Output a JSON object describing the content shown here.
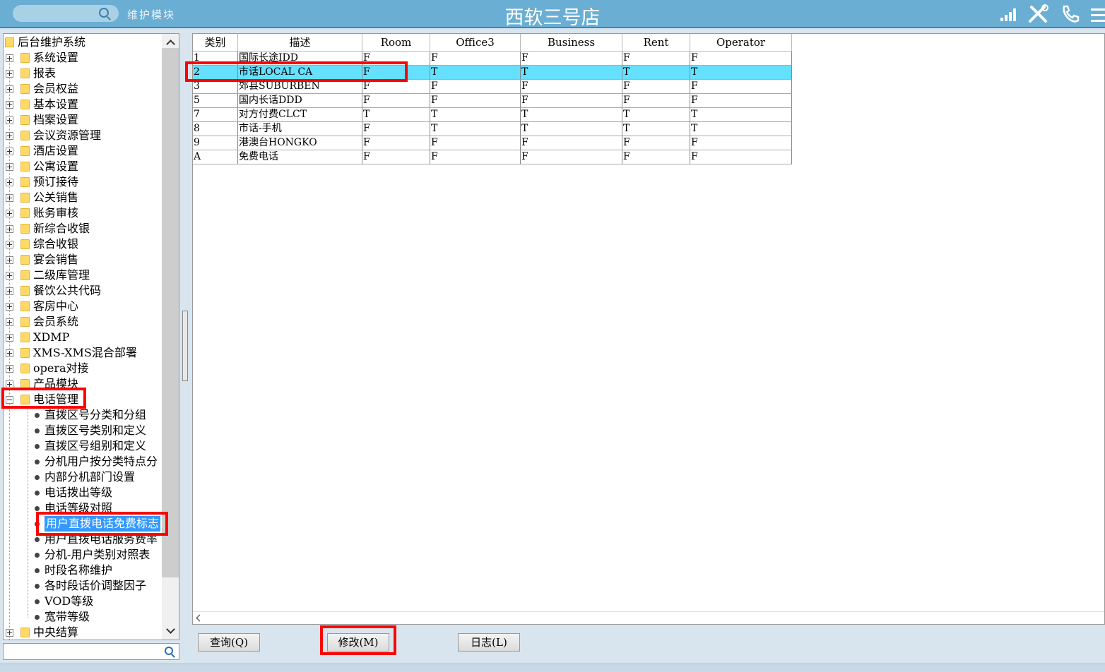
{
  "header": {
    "search_placeholder": "",
    "module_title": "维护模块",
    "app_title": "西软三号店",
    "icons": [
      "signal-icon",
      "tools-icon",
      "phone-icon",
      "menu-icon"
    ]
  },
  "tree": {
    "root": "后台维护系统",
    "groups": [
      "系统设置",
      "报表",
      "会员权益",
      "基本设置",
      "档案设置",
      "会议资源管理",
      "酒店设置",
      "公寓设置",
      "预订接待",
      "公关销售",
      "账务审核",
      "新综合收银",
      "综合收银",
      "宴会销售",
      "二级库管理",
      "餐饮公共代码",
      "客房中心",
      "会员系统",
      "XDMP",
      "XMS-XMS混合部署",
      "opera对接",
      "产品模块",
      "电话管理"
    ],
    "phone_children": [
      "直拨区号分类和分组",
      "直拨区号类别和定义",
      "直拨区号组别和定义",
      "分机用户按分类特点分",
      "内部分机部门设置",
      "电话拨出等级",
      "电话等级对照",
      "用户直拨电话免费标志",
      "用户直拨电话服务费率",
      "分机-用户类别对照表",
      "时段名称维护",
      "各时段话价调整因子",
      "VOD等级",
      "宽带等级"
    ],
    "last_group": "中央结算",
    "selected_child": "用户直拨电话免费标志"
  },
  "grid": {
    "columns": [
      "类别",
      "描述",
      "Room",
      "Office3",
      "Business",
      "Rent",
      "Operator"
    ],
    "rows": [
      [
        "1",
        "国际长途IDD",
        "F",
        "F",
        "F",
        "F",
        "F"
      ],
      [
        "2",
        "市话LOCAL CA",
        "F",
        "T",
        "T",
        "T",
        "T"
      ],
      [
        "3",
        "郊县SUBURBEN",
        "F",
        "F",
        "F",
        "F",
        "F"
      ],
      [
        "5",
        "国内长话DDD",
        "F",
        "F",
        "F",
        "F",
        "F"
      ],
      [
        "7",
        "对方付费CLCT",
        "T",
        "T",
        "T",
        "T",
        "T"
      ],
      [
        "8",
        "市话-手机",
        "F",
        "T",
        "T",
        "T",
        "T"
      ],
      [
        "9",
        "港澳台HONGKO",
        "F",
        "F",
        "F",
        "F",
        "F"
      ],
      [
        "A",
        "免费电话",
        "F",
        "F",
        "F",
        "F",
        "F"
      ]
    ],
    "selected_row": 1
  },
  "buttons": {
    "query": "查询(Q)",
    "modify": "修改(M)",
    "log": "日志(L)"
  },
  "colors": {
    "header_bg": "#6aaed3",
    "selected_row_bg": "#66e0ff",
    "selected_tree_bg": "#3399ff",
    "highlight_border": "#ff0000"
  }
}
